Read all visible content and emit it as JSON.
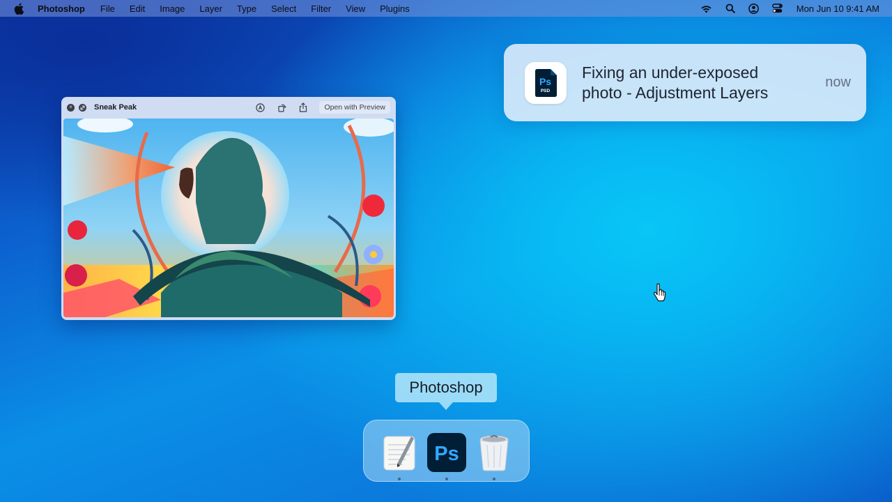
{
  "menubar": {
    "app_name": "Photoshop",
    "items": [
      "File",
      "Edit",
      "Image",
      "Layer",
      "Type",
      "Select",
      "Filter",
      "View",
      "Plugins"
    ],
    "status_icons": [
      "wifi-icon",
      "search-icon",
      "user-icon",
      "control-center-icon"
    ],
    "clock": "Mon Jun 10  9:41 AM"
  },
  "notification": {
    "icon_label": "Ps",
    "icon_sublabel": "PSD",
    "title": "Fixing an under-exposed photo - Adjustment Layers",
    "time": "now"
  },
  "quicklook": {
    "title": "Sneak Peak",
    "open_button": "Open with Preview",
    "tools": [
      "markup-icon",
      "rotate-icon",
      "share-icon"
    ]
  },
  "dock": {
    "tooltip": "Photoshop",
    "items": [
      {
        "name": "TextEdit",
        "icon": "textedit-icon"
      },
      {
        "name": "Photoshop",
        "icon": "photoshop-icon",
        "label": "Ps"
      },
      {
        "name": "Trash",
        "icon": "trash-icon"
      }
    ]
  },
  "colors": {
    "photoshop_bg": "#001e36",
    "photoshop_fg": "#31a8ff"
  }
}
